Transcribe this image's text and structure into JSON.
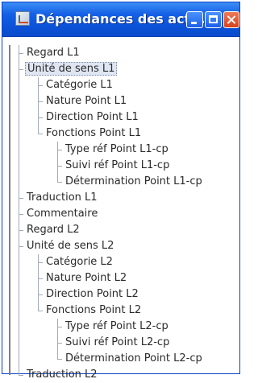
{
  "window": {
    "title": "Dépendances des act..."
  },
  "tree": {
    "nodes": [
      {
        "label": "Regard L1",
        "level": 0
      },
      {
        "label": "Unité de sens L1",
        "level": 0,
        "selected": true
      },
      {
        "label": "Catégorie L1",
        "level": 1
      },
      {
        "label": "Nature Point L1",
        "level": 1
      },
      {
        "label": "Direction Point L1",
        "level": 1
      },
      {
        "label": "Fonctions Point L1",
        "level": 1
      },
      {
        "label": "Type réf Point L1-cp",
        "level": 2
      },
      {
        "label": "Suivi réf Point L1-cp",
        "level": 2
      },
      {
        "label": "Détermination Point L1-cp",
        "level": 2
      },
      {
        "label": "Traduction L1",
        "level": 0
      },
      {
        "label": "Commentaire",
        "level": 0
      },
      {
        "label": "Regard L2",
        "level": 0
      },
      {
        "label": "Unité de sens L2",
        "level": 0
      },
      {
        "label": "Catégorie L2",
        "level": 1
      },
      {
        "label": "Nature Point L2",
        "level": 1
      },
      {
        "label": "Direction Point L2",
        "level": 1
      },
      {
        "label": "Fonctions Point L2",
        "level": 1
      },
      {
        "label": "Type réf Point L2-cp",
        "level": 2
      },
      {
        "label": "Suivi réf Point L2-cp",
        "level": 2
      },
      {
        "label": "Détermination Point L2-cp",
        "level": 2
      },
      {
        "label": "Traduction L2",
        "level": 0
      }
    ]
  }
}
